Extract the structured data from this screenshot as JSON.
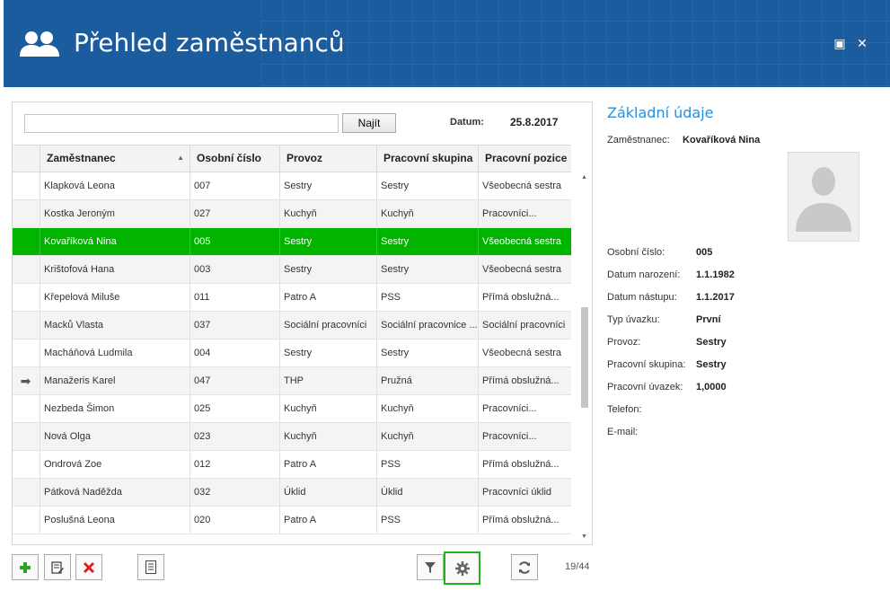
{
  "window": {
    "title": "Přehled zaměstnanců",
    "maximize_glyph": "▣",
    "close_glyph": "✕"
  },
  "search": {
    "value": "",
    "placeholder": "",
    "find_label": "Najít",
    "date_label": "Datum:",
    "date_value": "25.8.2017"
  },
  "grid": {
    "columns": [
      "Zaměstnanec",
      "Osobní číslo",
      "Provoz",
      "Pracovní skupina",
      "Pracovní pozice"
    ],
    "sort_indicator": "▲",
    "rows": [
      {
        "name": "Klapková Leona",
        "id": "007",
        "provoz": "Sestry",
        "skupina": "Sestry",
        "pozice": "Všeobecná sestra",
        "indicator": ""
      },
      {
        "name": "Kostka Jeroným",
        "id": "027",
        "provoz": "Kuchyň",
        "skupina": "Kuchyň",
        "pozice": "Pracovníci...",
        "indicator": ""
      },
      {
        "name": "Kovaříková Nina",
        "id": "005",
        "provoz": "Sestry",
        "skupina": "Sestry",
        "pozice": "Všeobecná sestra",
        "indicator": ""
      },
      {
        "name": "Krištofová Hana",
        "id": "003",
        "provoz": "Sestry",
        "skupina": "Sestry",
        "pozice": "Všeobecná sestra",
        "indicator": ""
      },
      {
        "name": "Křepelová Miluše",
        "id": "011",
        "provoz": "Patro A",
        "skupina": "PSS",
        "pozice": "Přímá obslužná...",
        "indicator": ""
      },
      {
        "name": "Macků Vlasta",
        "id": "037",
        "provoz": "Sociální pracovníci",
        "skupina": "Sociální pracovnice ...",
        "pozice": "Sociální pracovníci",
        "indicator": ""
      },
      {
        "name": "Macháňová Ludmila",
        "id": "004",
        "provoz": "Sestry",
        "skupina": "Sestry",
        "pozice": "Všeobecná sestra",
        "indicator": ""
      },
      {
        "name": "Manažeris Karel",
        "id": "047",
        "provoz": "THP",
        "skupina": "Pružná",
        "pozice": "Přímá obslužná...",
        "indicator": "➡"
      },
      {
        "name": "Nezbeda Šimon",
        "id": "025",
        "provoz": "Kuchyň",
        "skupina": "Kuchyň",
        "pozice": "Pracovníci...",
        "indicator": ""
      },
      {
        "name": "Nová Olga",
        "id": "023",
        "provoz": "Kuchyň",
        "skupina": "Kuchyň",
        "pozice": "Pracovníci...",
        "indicator": ""
      },
      {
        "name": "Ondrová Zoe",
        "id": "012",
        "provoz": "Patro A",
        "skupina": "PSS",
        "pozice": "Přímá obslužná...",
        "indicator": ""
      },
      {
        "name": "Pátková Naděžda",
        "id": "032",
        "provoz": "Úklid",
        "skupina": "Úklid",
        "pozice": "Pracovníci úklid",
        "indicator": ""
      },
      {
        "name": "Poslušná Leona",
        "id": "020",
        "provoz": "Patro A",
        "skupina": "PSS",
        "pozice": "Přímá obslužná...",
        "indicator": ""
      }
    ],
    "selected_index": 2,
    "counter": "19/44"
  },
  "toolbar": {
    "add_icon": "plus-icon",
    "edit_icon": "edit-icon",
    "delete_icon": "delete-icon",
    "report_icon": "report-icon",
    "filter_icon": "filter-icon",
    "settings_icon": "gear-icon",
    "refresh_icon": "refresh-icon"
  },
  "detail": {
    "section_title": "Základní údaje",
    "employee_label": "Zaměstnanec:",
    "employee_value": "Kovaříková Nina",
    "fields": [
      {
        "label": "Osobní číslo:",
        "value": "005"
      },
      {
        "label": "Datum narození:",
        "value": "1.1.1982"
      },
      {
        "label": "Datum nástupu:",
        "value": "1.1.2017"
      },
      {
        "label": "Typ úvazku:",
        "value": "První"
      },
      {
        "label": "Provoz:",
        "value": "Sestry"
      },
      {
        "label": "Pracovní skupina:",
        "value": "Sestry"
      },
      {
        "label": "Pracovní úvazek:",
        "value": "1,0000"
      },
      {
        "label": "Telefon:",
        "value": ""
      },
      {
        "label": "E-mail:",
        "value": ""
      }
    ]
  },
  "colors": {
    "header_bg": "#1b5c9e",
    "selected_row": "#00b400",
    "accent_title": "#2a8fd8",
    "highlight_border": "#20b020",
    "delete_red": "#e02020",
    "add_green": "#2aa52a"
  }
}
